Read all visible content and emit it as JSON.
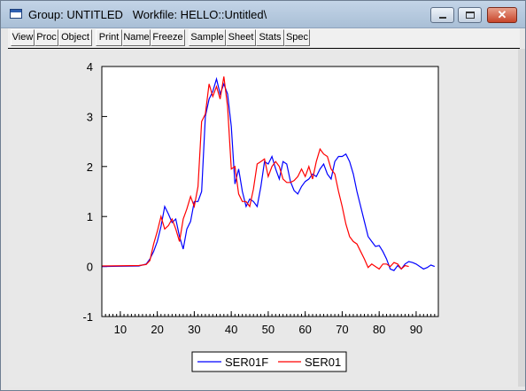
{
  "window": {
    "title": "Group: UNTITLED   Workfile: HELLO::Untitled\\",
    "close_glyph": "✕"
  },
  "toolbar": {
    "buttons": [
      "View",
      "Proc",
      "Object",
      "Print",
      "Name",
      "Freeze",
      "Sample",
      "Sheet",
      "Stats",
      "Spec"
    ]
  },
  "chart_data": {
    "type": "line",
    "xlim": [
      5,
      96
    ],
    "ylim": [
      -1,
      4
    ],
    "xticks": [
      10,
      20,
      30,
      40,
      50,
      60,
      70,
      80,
      90
    ],
    "yticks": [
      -1,
      0,
      1,
      2,
      3,
      4
    ],
    "grid": false,
    "legend_position": "bottom-center",
    "series": [
      {
        "name": "SER01F",
        "color": "#0000ff",
        "points": [
          [
            5,
            0
          ],
          [
            15,
            0.01
          ],
          [
            17,
            0.05
          ],
          [
            18,
            0.15
          ],
          [
            19,
            0.3
          ],
          [
            20,
            0.5
          ],
          [
            21,
            0.8
          ],
          [
            22,
            1.2
          ],
          [
            23,
            1.05
          ],
          [
            24,
            0.88
          ],
          [
            25,
            0.95
          ],
          [
            26,
            0.6
          ],
          [
            27,
            0.35
          ],
          [
            28,
            0.75
          ],
          [
            29,
            0.9
          ],
          [
            30,
            1.3
          ],
          [
            31,
            1.3
          ],
          [
            32,
            1.5
          ],
          [
            33,
            3.0
          ],
          [
            34,
            3.35
          ],
          [
            35,
            3.5
          ],
          [
            36,
            3.75
          ],
          [
            37,
            3.45
          ],
          [
            38,
            3.65
          ],
          [
            39,
            3.45
          ],
          [
            40,
            2.8
          ],
          [
            41,
            1.65
          ],
          [
            42,
            1.95
          ],
          [
            43,
            1.5
          ],
          [
            44,
            1.2
          ],
          [
            45,
            1.35
          ],
          [
            46,
            1.3
          ],
          [
            47,
            1.2
          ],
          [
            48,
            1.6
          ],
          [
            49,
            2.1
          ],
          [
            50,
            2.05
          ],
          [
            51,
            2.2
          ],
          [
            52,
            1.95
          ],
          [
            53,
            1.75
          ],
          [
            54,
            2.1
          ],
          [
            55,
            2.05
          ],
          [
            56,
            1.7
          ],
          [
            57,
            1.52
          ],
          [
            58,
            1.45
          ],
          [
            59,
            1.6
          ],
          [
            60,
            1.7
          ],
          [
            61,
            1.75
          ],
          [
            62,
            1.85
          ],
          [
            63,
            1.8
          ],
          [
            64,
            1.95
          ],
          [
            65,
            2.05
          ],
          [
            66,
            1.85
          ],
          [
            67,
            1.75
          ],
          [
            68,
            2.1
          ],
          [
            69,
            2.2
          ],
          [
            70,
            2.2
          ],
          [
            71,
            2.25
          ],
          [
            72,
            2.1
          ],
          [
            73,
            1.85
          ],
          [
            74,
            1.5
          ],
          [
            75,
            1.2
          ],
          [
            76,
            0.9
          ],
          [
            77,
            0.6
          ],
          [
            78,
            0.5
          ],
          [
            79,
            0.4
          ],
          [
            80,
            0.42
          ],
          [
            81,
            0.3
          ],
          [
            82,
            0.15
          ],
          [
            83,
            -0.05
          ],
          [
            84,
            -0.08
          ],
          [
            85,
            0.02
          ],
          [
            86,
            -0.05
          ],
          [
            87,
            0.05
          ],
          [
            88,
            0.1
          ],
          [
            89,
            0.08
          ],
          [
            90,
            0.05
          ],
          [
            91,
            0.0
          ],
          [
            92,
            -0.05
          ],
          [
            93,
            -0.02
          ],
          [
            94,
            0.03
          ],
          [
            95,
            0.0
          ]
        ]
      },
      {
        "name": "SER01",
        "color": "#ff0000",
        "points": [
          [
            5,
            0.01
          ],
          [
            15,
            0.02
          ],
          [
            17,
            0.04
          ],
          [
            18,
            0.12
          ],
          [
            19,
            0.45
          ],
          [
            20,
            0.7
          ],
          [
            21,
            1.0
          ],
          [
            22,
            0.75
          ],
          [
            23,
            0.82
          ],
          [
            24,
            0.95
          ],
          [
            25,
            0.75
          ],
          [
            26,
            0.5
          ],
          [
            27,
            0.95
          ],
          [
            28,
            1.15
          ],
          [
            29,
            1.4
          ],
          [
            30,
            1.2
          ],
          [
            31,
            1.6
          ],
          [
            32,
            2.9
          ],
          [
            33,
            3.05
          ],
          [
            34,
            3.65
          ],
          [
            35,
            3.4
          ],
          [
            36,
            3.6
          ],
          [
            37,
            3.35
          ],
          [
            38,
            3.8
          ],
          [
            39,
            3.2
          ],
          [
            40,
            1.95
          ],
          [
            41,
            2.0
          ],
          [
            42,
            1.45
          ],
          [
            43,
            1.3
          ],
          [
            44,
            1.3
          ],
          [
            45,
            1.2
          ],
          [
            46,
            1.55
          ],
          [
            47,
            2.05
          ],
          [
            48,
            2.1
          ],
          [
            49,
            2.15
          ],
          [
            50,
            1.8
          ],
          [
            51,
            2.0
          ],
          [
            52,
            2.1
          ],
          [
            53,
            2.0
          ],
          [
            54,
            1.75
          ],
          [
            55,
            1.68
          ],
          [
            56,
            1.68
          ],
          [
            57,
            1.72
          ],
          [
            58,
            1.8
          ],
          [
            59,
            1.95
          ],
          [
            60,
            1.8
          ],
          [
            61,
            2.0
          ],
          [
            62,
            1.75
          ],
          [
            63,
            2.1
          ],
          [
            64,
            2.35
          ],
          [
            65,
            2.25
          ],
          [
            66,
            2.2
          ],
          [
            67,
            1.95
          ],
          [
            68,
            1.85
          ],
          [
            69,
            1.5
          ],
          [
            70,
            1.2
          ],
          [
            71,
            0.85
          ],
          [
            72,
            0.6
          ],
          [
            73,
            0.5
          ],
          [
            74,
            0.45
          ],
          [
            75,
            0.3
          ],
          [
            76,
            0.15
          ],
          [
            77,
            -0.02
          ],
          [
            78,
            0.05
          ],
          [
            79,
            0.0
          ],
          [
            80,
            -0.05
          ],
          [
            81,
            0.05
          ],
          [
            82,
            0.05
          ],
          [
            83,
            0.0
          ],
          [
            84,
            0.08
          ],
          [
            85,
            0.05
          ],
          [
            86,
            -0.05
          ],
          [
            87,
            0.02
          ],
          [
            88,
            0.0
          ]
        ]
      }
    ]
  }
}
